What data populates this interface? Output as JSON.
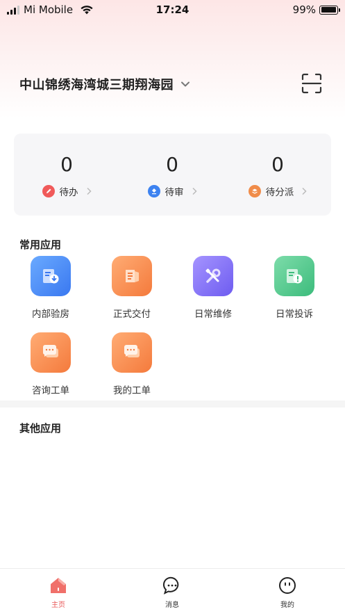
{
  "status_bar": {
    "carrier": "Mi Mobile",
    "time": "17:24",
    "battery": "99%",
    "battery_level": 0.99
  },
  "header": {
    "project_name": "中山锦绣海湾城三期翔海园",
    "scan_icon": "scan-icon"
  },
  "stats": [
    {
      "value": "0",
      "label": "待办",
      "icon": "pen-icon",
      "color": "#f05a5a"
    },
    {
      "value": "0",
      "label": "待审",
      "icon": "stamp-icon",
      "color": "#3d82f0"
    },
    {
      "value": "0",
      "label": "待分派",
      "icon": "dispatch-icon",
      "color": "#f08c4a"
    }
  ],
  "common_apps": {
    "title": "常用应用",
    "items": [
      {
        "label": "内部验房",
        "icon": "house-inspection-icon",
        "color_from": "#5aa0ff",
        "color_to": "#3a78f0"
      },
      {
        "label": "正式交付",
        "icon": "delivery-icon",
        "color_from": "#ffa064",
        "color_to": "#f47a3c"
      },
      {
        "label": "日常维修",
        "icon": "wrench-icon",
        "color_from": "#9a86ff",
        "color_to": "#6e5cf0"
      },
      {
        "label": "日常投诉",
        "icon": "complaint-icon",
        "color_from": "#6ed6a0",
        "color_to": "#3cbc7c"
      },
      {
        "label": "咨询工单",
        "icon": "chat-icon",
        "color_from": "#ffa064",
        "color_to": "#f47a3c"
      },
      {
        "label": "我的工单",
        "icon": "chat-icon",
        "color_from": "#ffa064",
        "color_to": "#f47a3c"
      }
    ]
  },
  "other_apps": {
    "title": "其他应用"
  },
  "tab_bar": {
    "items": [
      {
        "label": "主页",
        "icon": "home-icon",
        "active": true
      },
      {
        "label": "消息",
        "icon": "message-icon",
        "active": false
      },
      {
        "label": "我的",
        "icon": "profile-icon",
        "active": false
      }
    ]
  },
  "colors": {
    "accent": "#e85a5a",
    "card_bg": "#f6f6f8"
  }
}
